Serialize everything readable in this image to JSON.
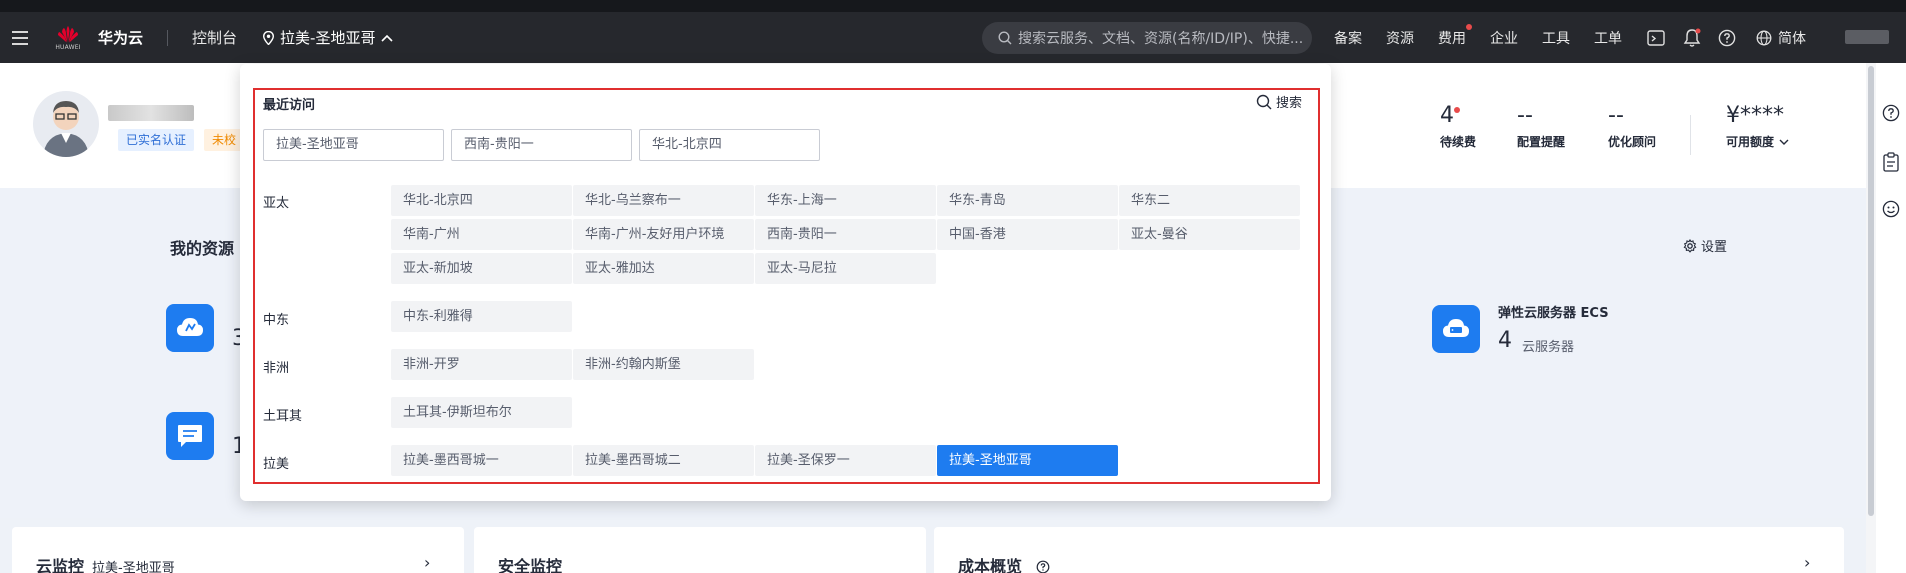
{
  "topbar": {
    "logo_text": "HUAWEI",
    "brand": "华为云",
    "console": "控制台",
    "region": "拉美-圣地亚哥",
    "search_placeholder": "搜索云服务、文档、资源(名称/ID/IP)、快捷...",
    "nav": [
      "备案",
      "资源",
      "费用",
      "企业",
      "工具",
      "工单"
    ],
    "lang": "简体"
  },
  "profile": {
    "badges": [
      "已实名认证",
      "未校"
    ],
    "stats": [
      {
        "value": "4",
        "label": "待续费"
      },
      {
        "value": "--",
        "label": "配置提醒"
      },
      {
        "value": "--",
        "label": "优化顾问"
      },
      {
        "value": "¥****",
        "label": "可用额度"
      }
    ]
  },
  "resources": {
    "title": "我的资源",
    "settings": "设置",
    "left_digit_1": "3",
    "left_digit_2": "1",
    "ecs_title": "弹性云服务器 ECS",
    "ecs_count": "4",
    "ecs_unit": "云服务器"
  },
  "cards": [
    {
      "title": "云监控",
      "sub": "拉美-圣地亚哥"
    },
    {
      "title": "安全监控",
      "sub": ""
    },
    {
      "title": "成本概览",
      "sub": ""
    }
  ],
  "dropdown": {
    "recent_title": "最近访问",
    "search_label": "搜索",
    "recent": [
      "拉美-圣地亚哥",
      "西南-贵阳一",
      "华北-北京四"
    ],
    "groups": [
      {
        "label": "亚太",
        "regions": [
          "华北-北京四",
          "华北-乌兰察布一",
          "华东-上海一",
          "华东-青岛",
          "华东二",
          "华南-广州",
          "华南-广州-友好用户环境",
          "西南-贵阳一",
          "中国-香港",
          "亚太-曼谷",
          "亚太-新加坡",
          "亚太-雅加达",
          "亚太-马尼拉"
        ]
      },
      {
        "label": "中东",
        "regions": [
          "中东-利雅得"
        ]
      },
      {
        "label": "非洲",
        "regions": [
          "非洲-开罗",
          "非洲-约翰内斯堡"
        ]
      },
      {
        "label": "土耳其",
        "regions": [
          "土耳其-伊斯坦布尔"
        ]
      },
      {
        "label": "拉美",
        "regions": [
          "拉美-墨西哥城一",
          "拉美-墨西哥城二",
          "拉美-圣保罗一",
          "拉美-圣地亚哥"
        ]
      }
    ],
    "active_region": "拉美-圣地亚哥"
  },
  "colors": {
    "accent": "#1e7cf0",
    "highlight_box": "#e02f2f",
    "topbar": "#26282d"
  }
}
